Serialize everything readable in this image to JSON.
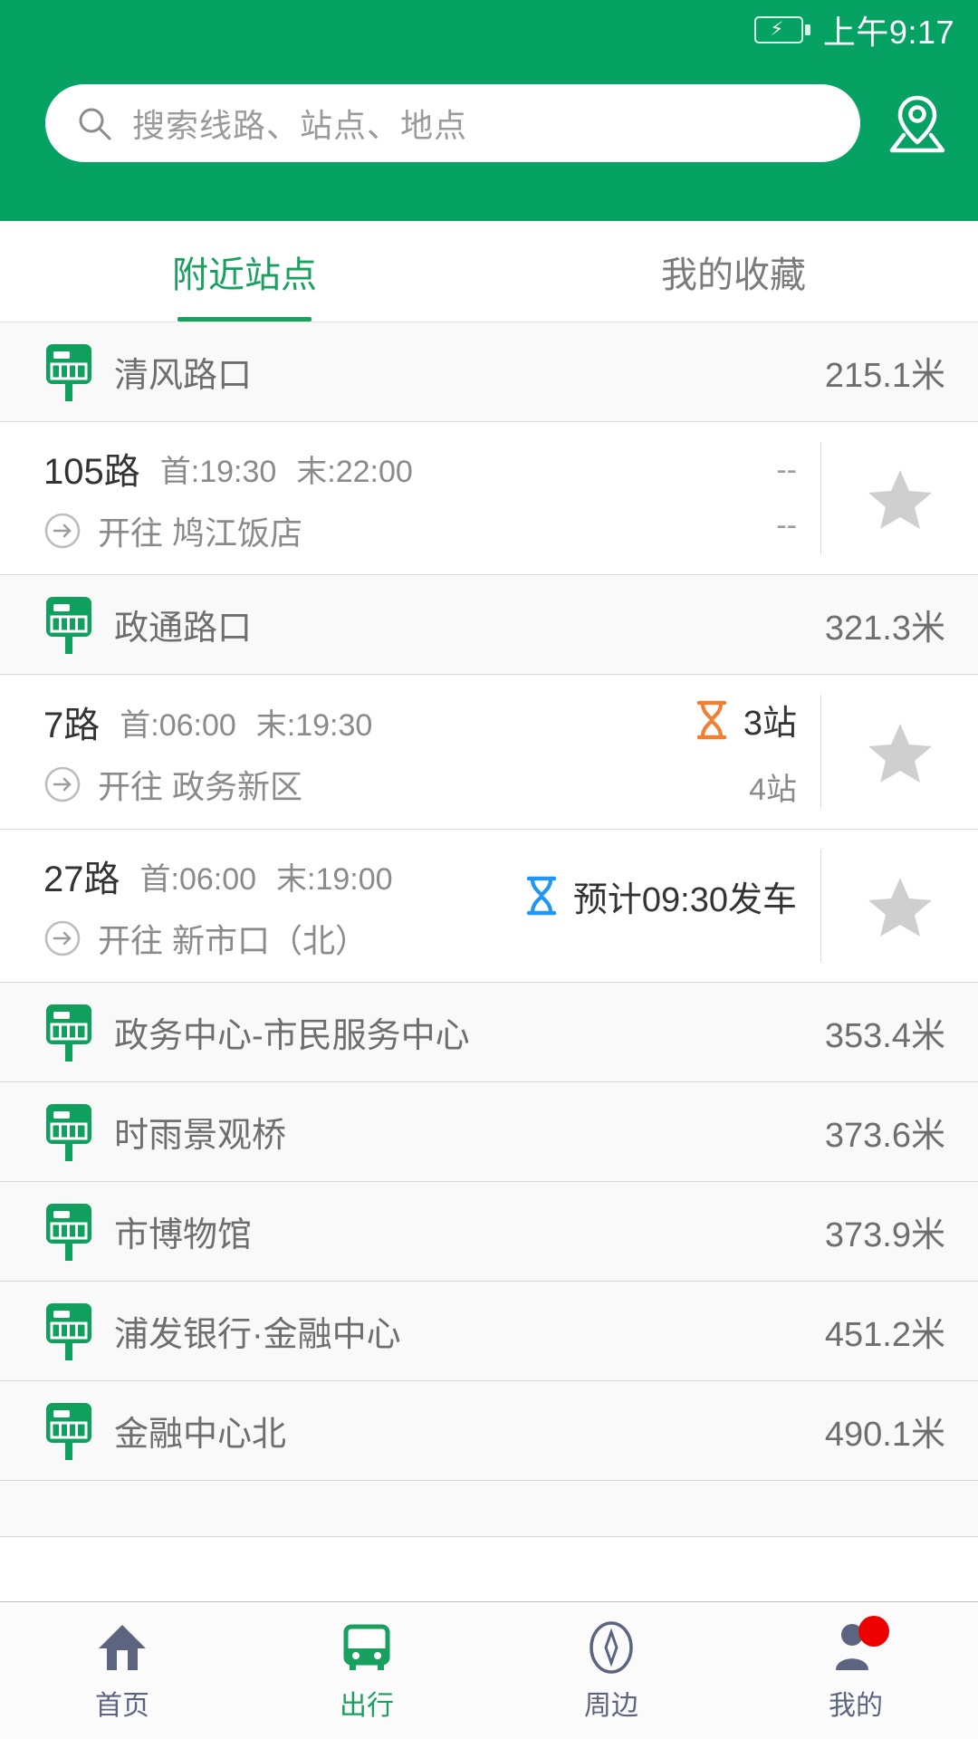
{
  "statusbar": {
    "battery_icon": "battery-charging-icon",
    "time": "上午9:17"
  },
  "header": {
    "background_color": "#06A263",
    "search": {
      "placeholder": "搜索线路、站点、地点",
      "value": "",
      "icon": "search-icon"
    },
    "location_button_icon": "map-pin-icon"
  },
  "tabs": {
    "active_color": "#17a05e",
    "items": [
      {
        "label": "附近站点",
        "active": true
      },
      {
        "label": "我的收藏",
        "active": false
      }
    ]
  },
  "list": [
    {
      "type": "station",
      "icon": "bus-stop-icon",
      "name": "清风路口",
      "distance": "215.1米"
    },
    {
      "type": "route",
      "number": "105路",
      "first": "首:19:30",
      "last": "末:22:00",
      "dest_icon": "arrow-circle-right-icon",
      "dest": "开往 鸠江饭店",
      "status_icon": null,
      "status_icon_color": null,
      "status_top": "--",
      "status_bottom": "--",
      "status_dim": true,
      "favorite_icon": "star-icon",
      "favorited": false
    },
    {
      "type": "station",
      "icon": "bus-stop-icon",
      "name": "政通路口",
      "distance": "321.3米"
    },
    {
      "type": "route",
      "number": "7路",
      "first": "首:06:00",
      "last": "末:19:30",
      "dest_icon": "arrow-circle-right-icon",
      "dest": "开往 政务新区",
      "status_icon": "hourglass-icon",
      "status_icon_color": "#F08133",
      "status_top": "3站",
      "status_bottom": "4站",
      "status_dim": false,
      "favorite_icon": "star-icon",
      "favorited": false
    },
    {
      "type": "route",
      "number": "27路",
      "first": "首:06:00",
      "last": "末:19:00",
      "dest_icon": "arrow-circle-right-icon",
      "dest": "开往 新市口（北）",
      "status_icon": "hourglass-icon",
      "status_icon_color": "#2196F3",
      "status_top": "预计09:30发车",
      "status_bottom": "",
      "status_dim": false,
      "favorite_icon": "star-icon",
      "favorited": false
    },
    {
      "type": "station",
      "icon": "bus-stop-icon",
      "name": "政务中心-市民服务中心",
      "distance": "353.4米"
    },
    {
      "type": "station",
      "icon": "bus-stop-icon",
      "name": "时雨景观桥",
      "distance": "373.6米"
    },
    {
      "type": "station",
      "icon": "bus-stop-icon",
      "name": "市博物馆",
      "distance": "373.9米"
    },
    {
      "type": "station",
      "icon": "bus-stop-icon",
      "name": "浦发银行·金融中心",
      "distance": "451.2米"
    },
    {
      "type": "station",
      "icon": "bus-stop-icon",
      "name": "金融中心北",
      "distance": "490.1米"
    }
  ],
  "bottomnav": {
    "items": [
      {
        "label": "首页",
        "icon": "home-icon",
        "active": false,
        "badge": false
      },
      {
        "label": "出行",
        "icon": "bus-icon",
        "active": true,
        "badge": false
      },
      {
        "label": "周边",
        "icon": "compass-icon",
        "active": false,
        "badge": false
      },
      {
        "label": "我的",
        "icon": "person-icon",
        "active": false,
        "badge": true
      }
    ]
  }
}
